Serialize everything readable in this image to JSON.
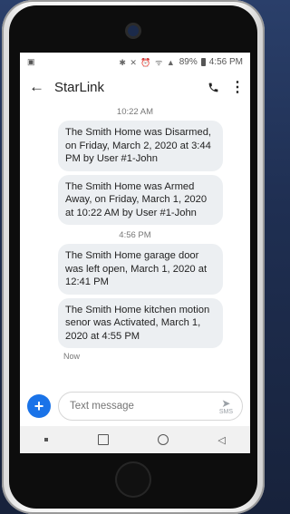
{
  "status_bar": {
    "time": "4:56 PM",
    "battery": "89%",
    "icons": "✱ ✕ ⏰ ᯤ ▲",
    "colors": {
      "text": "#555555"
    }
  },
  "app_bar": {
    "back_icon": "arrow-left-icon",
    "title": "StarLink",
    "call_icon": "phone-icon",
    "menu_icon": "more-vert-icon"
  },
  "conversation": {
    "groups": [
      {
        "timestamp": "10:22 AM",
        "messages": [
          "The Smith Home was Disarmed, on Friday, March 2, 2020 at 3:44 PM by User #1-John",
          "The Smith Home was Armed Away, on Friday, March 1, 2020 at 10:22 AM by User #1-John"
        ]
      },
      {
        "timestamp": "4:56 PM",
        "messages": [
          "The Smith Home garage door was left open, March 1, 2020 at 12:41 PM",
          "The Smith Home kitchen motion senor was Activated, March 1, 2020 at 4:55 PM"
        ]
      }
    ],
    "last_status": "Now"
  },
  "composer": {
    "add_icon": "plus-icon",
    "placeholder": "Text message",
    "send_label": "SMS",
    "accent": "#1a73e8"
  },
  "nav_bar": {
    "recent": "recent-apps-icon",
    "home": "home-icon",
    "back": "back-triangle-icon"
  }
}
